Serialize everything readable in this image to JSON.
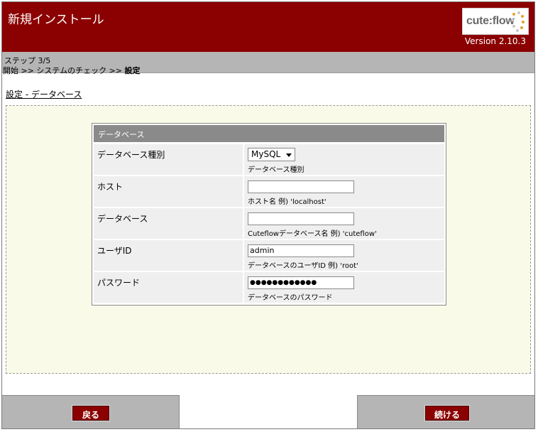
{
  "header": {
    "title": "新規インストール",
    "logo_text": "cute:flow",
    "version": "Version 2.10.3"
  },
  "steps": {
    "label": "ステップ 3/5",
    "path_prefix": "開始 >> システムのチェック >> ",
    "current": "設定"
  },
  "section": {
    "link": "設定 - データベース"
  },
  "database": {
    "heading": "データベース",
    "rows": [
      {
        "label": "データベース種別",
        "type": "select",
        "value": "MySQL",
        "hint": "データベース種別"
      },
      {
        "label": "ホスト",
        "type": "text",
        "value": "",
        "hint": "ホスト名 例) 'localhost'"
      },
      {
        "label": "データベース",
        "type": "text",
        "value": "",
        "hint": "Cuteflowデータベース名 例) 'cuteflow'"
      },
      {
        "label": "ユーザID",
        "type": "text",
        "value": "admin",
        "hint": "データベースのユーザID 例) 'root'"
      },
      {
        "label": "パスワード",
        "type": "password",
        "value": "●●●●●●●●●●●●",
        "hint": "データベースのパスワード"
      }
    ]
  },
  "footer": {
    "back_label": "戻る",
    "next_label": "続ける"
  },
  "colors": {
    "brand": "#8b0000",
    "bar": "#b5b5b5",
    "content_bg": "#fafae9"
  }
}
